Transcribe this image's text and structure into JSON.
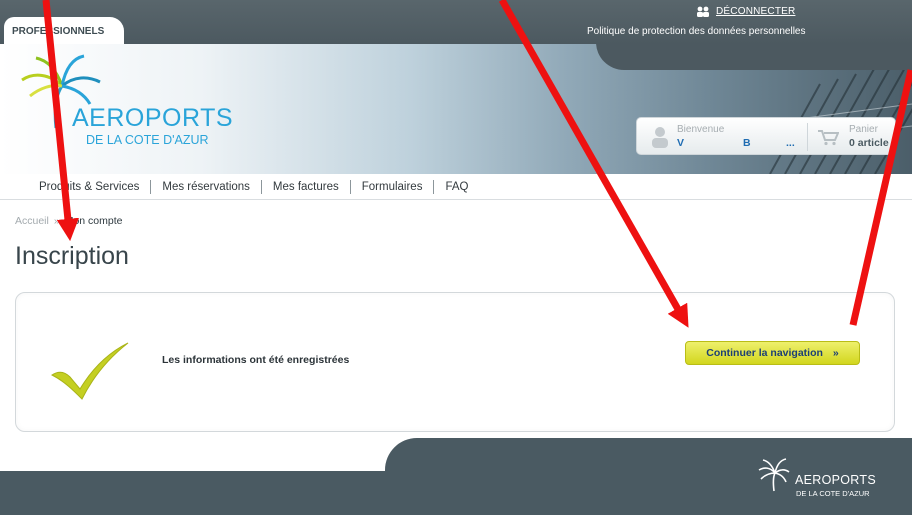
{
  "topbar": {
    "tab_label": "PROFESSIONNELS",
    "logout_label": "DÉCONNECTER",
    "privacy_link": "Politique de protection des données personnelles"
  },
  "logo": {
    "title": "AEROPORTS",
    "subtitle": "DE LA COTE D'AZUR"
  },
  "account": {
    "welcome_label": "Bienvenue",
    "name_first": "V",
    "name_last": "B",
    "name_more": "...",
    "cart_label": "Panier",
    "cart_count": "0 article"
  },
  "menu": {
    "items": [
      {
        "label": "Produits & Services"
      },
      {
        "label": "Mes réservations"
      },
      {
        "label": "Mes factures"
      },
      {
        "label": "Formulaires"
      },
      {
        "label": "FAQ"
      }
    ]
  },
  "breadcrumb": {
    "home": "Accueil",
    "separator": "»",
    "current": "Mon compte"
  },
  "page": {
    "title": "Inscription",
    "message": "Les informations ont été enregistrées",
    "continue_label": "Continuer la navigation",
    "continue_arrow": "»"
  },
  "footer": {
    "title": "AEROPORTS",
    "subtitle": "DE LA COTE D'AZUR"
  },
  "colors": {
    "brand_blue": "#2aa4d9",
    "header_gray": "#4a5a62",
    "button_yellow": "#d2d61e",
    "annotation_red": "#ee1111"
  },
  "annotations": {
    "arrow_count": 3,
    "arrow_color": "#ee1111"
  }
}
